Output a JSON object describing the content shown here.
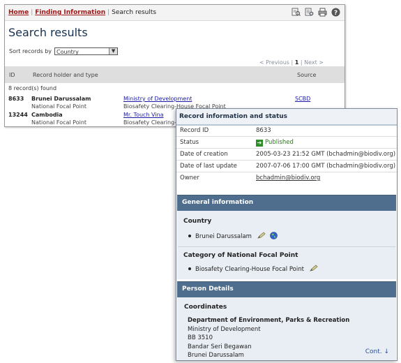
{
  "breadcrumb": {
    "home": "Home",
    "finding_information": "Finding Information",
    "current": "Search results",
    "separator": "|"
  },
  "toolbar_icons": [
    "search-records-icon",
    "search-list-icon",
    "print-icon",
    "help-icon"
  ],
  "page_title": "Search results",
  "sort": {
    "label": "Sort records by",
    "selected": "Country"
  },
  "pager": {
    "previous": "< Previous",
    "current_page": "1",
    "next": "Next >",
    "separator": "|"
  },
  "table": {
    "headers": {
      "id": "ID",
      "holder": "Record holder and type",
      "source": "Source"
    },
    "found_text": "8 record(s) found",
    "rows": [
      {
        "id": "8633",
        "name": "Brunei Darussalam",
        "type": "National Focal Point",
        "org": "Ministry of Development",
        "org_detail": "Biosafety Clearing-House Focal Point",
        "source": "SCBD"
      },
      {
        "id": "13244",
        "name": "Cambodia",
        "type": "National Focal Point",
        "org": "Mr. Touch Vina",
        "org_detail": "Biosafety Clearing-H"
      }
    ]
  },
  "record_info": {
    "title": "Record information and status",
    "fields": [
      {
        "label": "Record ID",
        "value": "8633"
      },
      {
        "label": "Status",
        "value": "Published"
      },
      {
        "label": "Date of creation",
        "value": "2005-03-23 21:52 GMT (bchadmin@biodiv.org)"
      },
      {
        "label": "Date of last update",
        "value": "2007-07-06 17:00 GMT (bchadmin@biodiv.org)"
      },
      {
        "label": "Owner",
        "value": "bchadmin@biodiv.org"
      }
    ]
  },
  "general_information": {
    "title": "General information",
    "country_label": "Country",
    "country": "Brunei Darussalam",
    "category_label": "Category of National Focal Point",
    "category": "Biosafety Clearing-House Focal Point"
  },
  "person_details": {
    "title": "Person Details",
    "coordinates_label": "Coordinates",
    "address_lines": [
      "Department of Environment, Parks & Recreation",
      "Ministry of Development",
      "BB 3510",
      "Bandar Seri Begawan",
      "Brunei Darussalam"
    ],
    "cont_label": "Cont. ↓"
  },
  "colors": {
    "breadcrumb_link": "#a01818",
    "section_bar": "#4f6d8c",
    "published": "#2a7a18",
    "link": "#1a1aa6"
  }
}
